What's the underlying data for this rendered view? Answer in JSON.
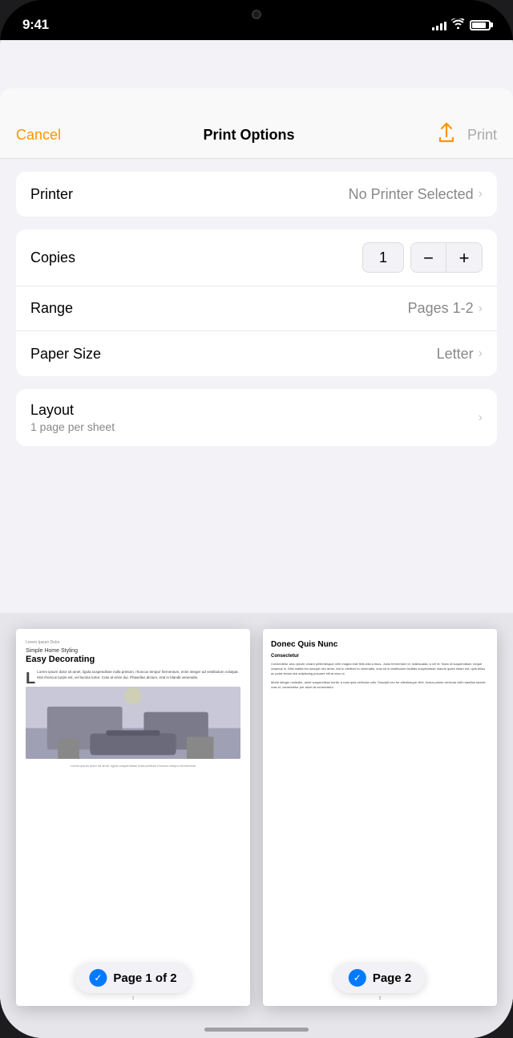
{
  "status_bar": {
    "time": "9:41",
    "signal_bars": [
      4,
      6,
      8,
      10,
      12
    ],
    "battery_percent": 85
  },
  "nav": {
    "cancel_label": "Cancel",
    "title": "Print Options",
    "share_icon": "↑",
    "print_label": "Print"
  },
  "printer_section": {
    "label": "Printer",
    "value": "No Printer Selected"
  },
  "options_section": {
    "copies": {
      "label": "Copies",
      "value": "1",
      "decrement": "−",
      "increment": "+"
    },
    "range": {
      "label": "Range",
      "value": "Pages 1-2"
    },
    "paper_size": {
      "label": "Paper Size",
      "value": "Letter"
    }
  },
  "layout_section": {
    "label": "Layout",
    "sublabel": "1 page per sheet"
  },
  "preview": {
    "page1": {
      "small_title": "Lorem Ipsum Dolor",
      "subtitle": "Simple Home Styling",
      "main_title": "Easy Decorating",
      "body": "Lorem ipsum dolor sit amet, ligula suspendisse nulla pretium, rhoncus tempor fermentum, enim integer ad vestibulum volutpat. Nisl rhoncus turpis est, vel lacinia tortor. Cras at enim dui. Phasellus dictum, erat in blandit venenatis.",
      "caption": "Lorem ipsum dolor sit amet, ligula suspendisse nulla pretium rhoncus tempor fermentum",
      "badge_text": "Page 1 of 2",
      "page_number": "1"
    },
    "page2": {
      "title": "Donec Quis Nunc",
      "subtitle": "Consectetur",
      "body": "Consectetur arcu ipsum ornare pellentesque vehi magna erat felis wisi a risus. Justo fermentum id, malesuada, a vel et. Nunc at suspendisse, neque vivamus in. Wisi mattis leo suscipit nec amet, nisl in eleifend in venenatis, cras sit in vestibulum facilisis suspendisse mauris quam etiam est, quis tellus ac porta lectus nisl adipiscing posuere elit at arcu ut.",
      "body2": "Morbi integer molestie, amet suspendisse hortis, a nam ipsa vehicula odio. Suscipit nec for ellentesque nibh, lectus primis vehicula velit nasellus lacinia cras id, consectetur per amet at consectetur.",
      "badge_text": "Page 2",
      "page_number": "2"
    }
  },
  "icons": {
    "chevron": "›",
    "check": "✓",
    "share": "⬆"
  }
}
